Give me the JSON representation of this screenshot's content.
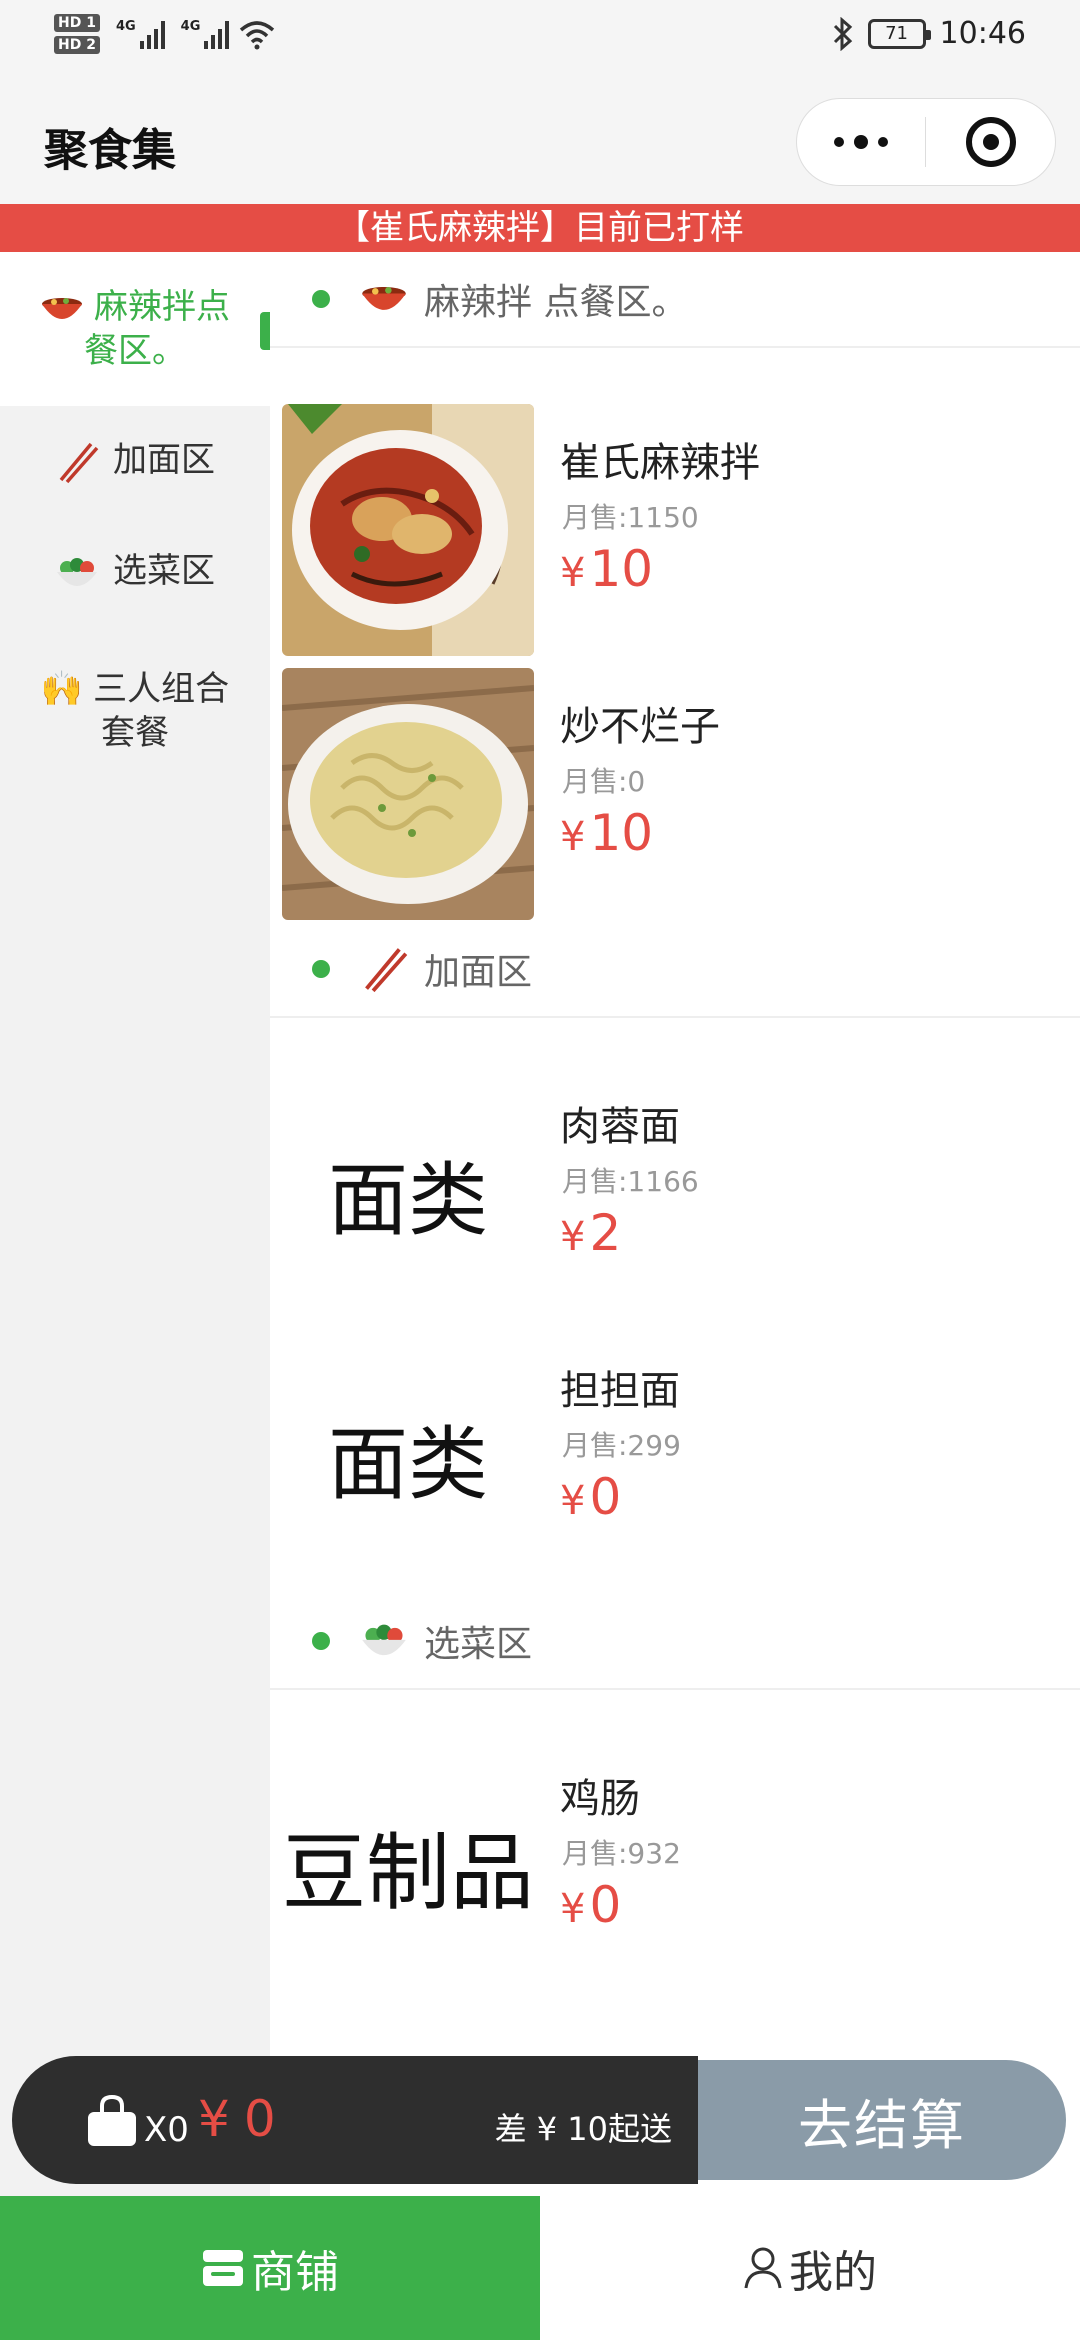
{
  "status_bar": {
    "hd1": "HD 1",
    "hd2": "HD 2",
    "net1": "4G",
    "net2": "4G",
    "battery": "71",
    "time": "10:46"
  },
  "title_bar": {
    "title": "聚食集",
    "more_icon": "more-dots-icon",
    "close_icon": "target-close-icon"
  },
  "notice": "【崔氏麻辣拌】目前已打样",
  "sidebar": {
    "items": [
      {
        "label": "麻辣拌点餐区。",
        "icon": "hotpot-bowl-icon",
        "active": true
      },
      {
        "label": "加面区",
        "icon": "chopsticks-icon",
        "active": false
      },
      {
        "label": "选菜区",
        "icon": "salad-icon",
        "active": false
      },
      {
        "label": "三人组合套餐",
        "icon": "raised-hands-icon",
        "active": false
      }
    ]
  },
  "sections": [
    {
      "title": "麻辣拌 点餐区。",
      "icon": "hotpot-bowl-icon",
      "products": [
        {
          "name": "崔氏麻辣拌",
          "sold": "月售:1150",
          "currency": "¥",
          "price": "10",
          "image": "spicy-mix-dish-photo"
        },
        {
          "name": "炒不烂子",
          "sold": "月售:0",
          "currency": "¥",
          "price": "10",
          "image": "fried-noodle-dish-photo"
        }
      ]
    },
    {
      "title": "加面区",
      "icon": "chopsticks-icon",
      "products": [
        {
          "name": "肉蓉面",
          "sold": "月售:1166",
          "currency": "¥",
          "price": "2",
          "image_text": "面类"
        },
        {
          "name": "担担面",
          "sold": "月售:299",
          "currency": "¥",
          "price": "0",
          "image_text": "面类"
        }
      ]
    },
    {
      "title": "选菜区",
      "icon": "salad-icon",
      "products": [
        {
          "name": "鸡肠",
          "sold": "月售:932",
          "currency": "¥",
          "price": "0",
          "image_text": "豆制品"
        }
      ]
    }
  ],
  "cart": {
    "count": "X0",
    "currency": "¥",
    "total": "0",
    "min_note": "差 ¥ 10起送",
    "checkout_label": "去结算"
  },
  "tabbar": {
    "shop_label": "商铺",
    "mine_label": "我的"
  },
  "colors": {
    "accent_green": "#3cb04a",
    "price_red": "#e54d45",
    "notice_red": "#e54d45",
    "checkout_gray": "#8a9ba8",
    "cart_dark": "#2e2e2e"
  }
}
